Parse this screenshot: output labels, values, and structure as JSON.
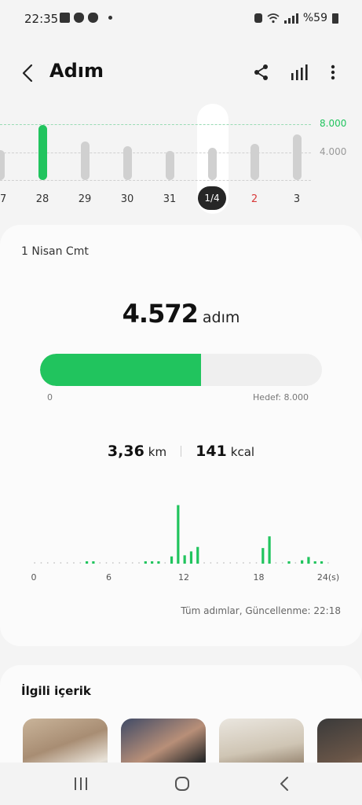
{
  "status_bar": {
    "time": "22:35",
    "battery": "%59",
    "icons": [
      "image-icon",
      "shield-icon",
      "shield-icon"
    ]
  },
  "header": {
    "title": "Adım"
  },
  "week_chart": {
    "goal_label": "8.000",
    "mid_label": "4.000",
    "max_value": 9000,
    "days": [
      {
        "label": "27",
        "value": 4200,
        "highlight": false,
        "weekend": false
      },
      {
        "label": "28",
        "value": 7800,
        "highlight": true,
        "weekend": false
      },
      {
        "label": "29",
        "value": 5500,
        "highlight": false,
        "weekend": false
      },
      {
        "label": "30",
        "value": 4800,
        "highlight": false,
        "weekend": false
      },
      {
        "label": "31",
        "value": 4100,
        "highlight": false,
        "weekend": false
      },
      {
        "label": "1/4",
        "value": 4572,
        "highlight": false,
        "weekend": false,
        "selected": true
      },
      {
        "label": "2",
        "value": 5100,
        "highlight": false,
        "weekend": true
      },
      {
        "label": "3",
        "value": 6400,
        "highlight": false,
        "weekend": false
      }
    ],
    "colors": {
      "green": "#21c45e",
      "gray": "#d0d0d0"
    }
  },
  "summary": {
    "date": "1 Nisan Cmt",
    "steps": "4.572",
    "steps_unit": "adım",
    "progress_fraction": 0.5715,
    "progress_min": "0",
    "goal_text": "Hedef: 8.000",
    "distance": "3,36",
    "distance_unit": "km",
    "calories": "141",
    "calories_unit": "kcal",
    "updated": "Tüm adımlar, Güncellenme: 22:18"
  },
  "chart_data": {
    "type": "bar",
    "x": [
      0,
      1,
      2,
      3,
      4,
      5,
      6,
      7,
      8,
      9,
      10,
      11,
      12,
      13,
      14,
      15,
      16,
      17,
      18,
      19,
      20,
      21,
      22,
      23
    ],
    "values": [
      0,
      0,
      0,
      0,
      40,
      0,
      0,
      0,
      40,
      40,
      130,
      1050,
      150,
      220,
      300,
      0,
      0,
      0,
      280,
      490,
      0,
      30,
      60,
      120
    ],
    "half_hour_values": [
      0,
      0,
      0,
      0,
      0,
      0,
      0,
      0,
      40,
      40,
      0,
      0,
      0,
      0,
      0,
      0,
      0,
      40,
      40,
      40,
      0,
      130,
      1050,
      150,
      220,
      300,
      0,
      0,
      0,
      0,
      0,
      0,
      0,
      0,
      0,
      280,
      490,
      0,
      0,
      30,
      0,
      60,
      120,
      30,
      40,
      0
    ],
    "tick_labels": [
      "0",
      "6",
      "12",
      "18",
      "24(s)"
    ],
    "ylim": [
      0,
      1100
    ],
    "color": "#21c45e"
  },
  "related": {
    "title": "İlgili içerik"
  }
}
